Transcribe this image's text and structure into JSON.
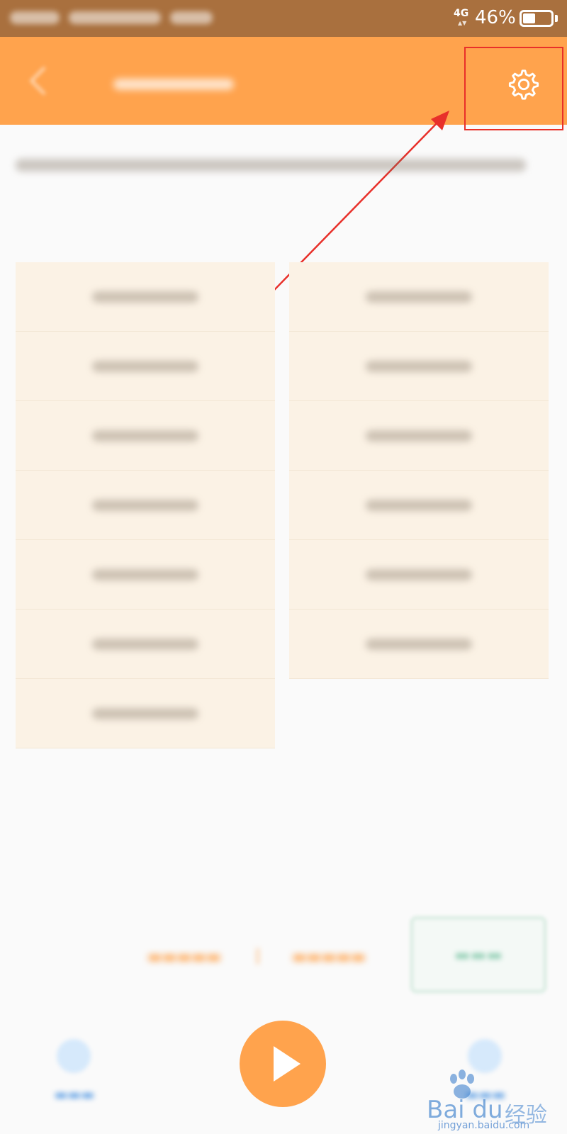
{
  "status_bar": {
    "network": "4G",
    "battery_percent": "46%",
    "battery_level": 0.46
  },
  "header": {
    "title": "",
    "settings_icon": "gear-icon",
    "back_icon": "chevron-left-icon"
  },
  "annotation": {
    "color": "#e8302a"
  },
  "description": "",
  "left_column": [
    {
      "label": ""
    },
    {
      "label": ""
    },
    {
      "label": ""
    },
    {
      "label": ""
    },
    {
      "label": ""
    },
    {
      "label": ""
    },
    {
      "label": ""
    }
  ],
  "right_column": [
    {
      "label": ""
    },
    {
      "label": ""
    },
    {
      "label": ""
    },
    {
      "label": ""
    },
    {
      "label": ""
    },
    {
      "label": ""
    }
  ],
  "mode_bar": {
    "separator": "|"
  },
  "bottom_nav": {
    "play_icon": "play-icon"
  },
  "watermark": {
    "brand": "Bai du",
    "text": "经验",
    "url": "jingyan.baidu.com"
  },
  "colors": {
    "header": "#ffa34d",
    "status_bar": "#a9703e",
    "accent": "#ffa34d",
    "item_bg": "#fbf2e5"
  }
}
